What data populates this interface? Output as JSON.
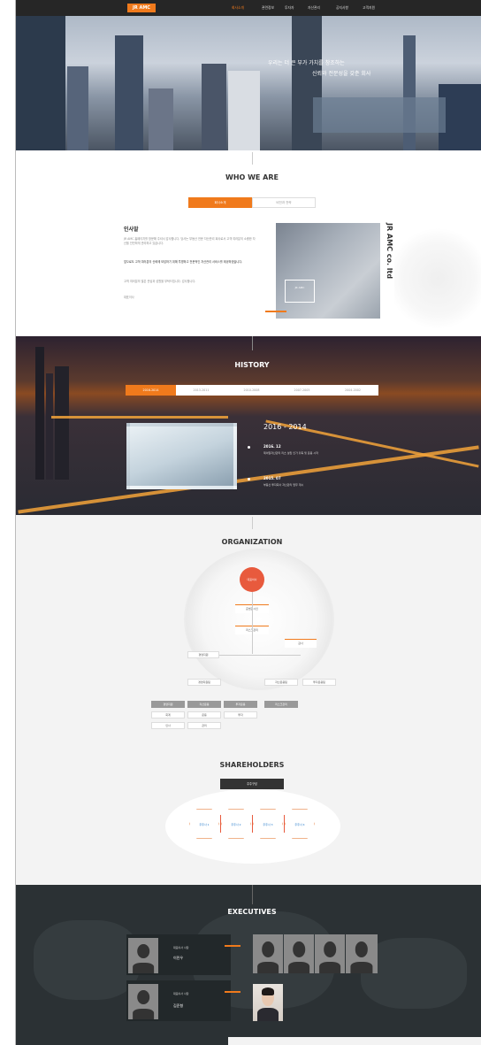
{
  "nav": {
    "logo": "JR AMC",
    "links": [
      "회사소개",
      "관련정보",
      "투자자",
      "자산관리",
      "공지사항",
      "고객지원"
    ],
    "active_index": 0
  },
  "hero": {
    "line1": "우리는 더 큰 부가 가치를 창조하는",
    "line2": "신뢰와 전문성을 갖춘 회사"
  },
  "who": {
    "title": "WHO WE ARE",
    "tabs": [
      "회사소개",
      "비전과 전략"
    ],
    "greeting_title": "인사말",
    "paragraph1": "JR AMC 홈페이지를 방문해 주셔서 감사합니다. 당사는 부동산 전문 자산관리 회사로서 고객 여러분의 소중한 자산을 안전하게 관리하고 있습니다.",
    "paragraph2": "앞으로도 고객 여러분의 신뢰에 보답하기 위해 투명하고 전문적인 자산관리 서비스를 제공하겠습니다.",
    "paragraph3": "고객 여러분의 많은 관심과 성원을 부탁드립니다. 감사합니다.",
    "signature": "대표이사",
    "photo_caption": "JR AMC",
    "vertical_text": "JR AMC co. ltd"
  },
  "history": {
    "title": "HISTORY",
    "tabs": [
      "2016-2014",
      "2013-2011",
      "2010-2008",
      "2007-2005",
      "2004-2002"
    ],
    "years": "2016 - 2014",
    "items": [
      {
        "date": "2016. 12",
        "text": "제이알자산관리 리츠 설립 인가 취득 및 운용 시작"
      },
      {
        "date": "2015. 07",
        "text": "부동산 투자회사 자산관리 업무 개시"
      }
    ]
  },
  "org": {
    "title": "ORGANIZATION",
    "top": "대표이사",
    "level1": "준법감시인",
    "level2": "리스크관리",
    "side": "감사",
    "branch_left": "경영지원",
    "row1": [
      "경영지원팀",
      "자산운용팀",
      "투자운용팀"
    ],
    "dark_row": [
      "경영지원",
      "자산운용",
      "투자운용",
      "리스크관리"
    ],
    "sub_row1": [
      "회계",
      "운용",
      "투자"
    ],
    "sub_row2": [
      "인사",
      "관리"
    ]
  },
  "shareholders": {
    "title": "SHAREHOLDERS",
    "bar": "주주구성",
    "hexes": [
      "주주사 1",
      "주주사 2",
      "주주사 3",
      "주주사 4"
    ]
  },
  "executives": {
    "title": "EXECUTIVES",
    "cards": [
      {
        "role": "대표이사 사장",
        "name": "이민우"
      },
      {
        "role": "대표이사 사장",
        "name": "김준형"
      }
    ]
  }
}
